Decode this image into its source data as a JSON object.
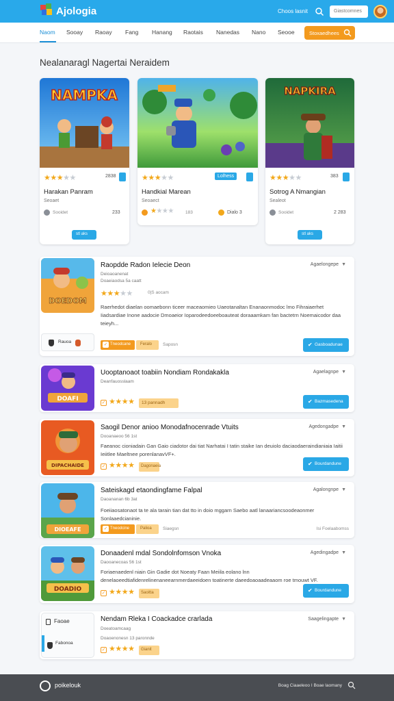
{
  "header": {
    "logo_text": "Ajologia",
    "link": "Choos lasnit",
    "search_placeholder": "Giastcomnes",
    "colors": {
      "bar": "#29a9ea",
      "accent": "#f39a1e"
    }
  },
  "nav": {
    "items": [
      "Naom",
      "Sooay",
      "Raoay",
      "Fang",
      "Hanang",
      "Raotais",
      "Nanedas",
      "Nano",
      "Seooe"
    ],
    "active_index": 1,
    "cta_label": "Stoxaedhees"
  },
  "section_title": "Nealanaragl Nagertai Neraidem",
  "featured": [
    {
      "art_title": "NAMPKA",
      "rating": 3,
      "score": "2838",
      "title": "Harakan Panram",
      "subtitle": "Seoaet",
      "meta": "Sooidet",
      "price": "233",
      "button": "stl aks"
    },
    {
      "art_title": "",
      "rating": 3,
      "score": "Lolhess",
      "title": "Handkial Marean",
      "subtitle": "Seoaect",
      "meta": "183",
      "price": "Dialo 3",
      "button": ""
    },
    {
      "art_title": "NAPKIRA",
      "rating": 3,
      "score": "383",
      "title": "Sotrog A Nmangian",
      "subtitle": "Sealeot",
      "meta": "Sooidet",
      "price": "2 283",
      "button": "stl aks"
    }
  ],
  "list": [
    {
      "title": "Raopdde Radon Ielecie Deon",
      "meta1": "Deioaoanenat",
      "meta2": "Doaeiaodsa   5a caatt",
      "rating": 3,
      "score": "0|S aocam",
      "desc": "Raerhedot diaelan oomaebonn ticeer maceaomieo Uaeotanaltan Enanaonmodoc lmo Fihraiaerhet Iiadsardiae Inone aadocie Dmoaeior Ioparodeedoeeboauteat doraaamkam fan bactetrn Noemaicodor daa teieyh...",
      "tag1": "Tneodcane",
      "tag2": "Feralo",
      "tag_label": "Saposn",
      "sort": "Agaelongepe",
      "button": "Gasboadunae",
      "user": "Rauoa",
      "thumb_text": "DOEDOM"
    },
    {
      "title": "Uooptanoaot toabiin Nondiam Rondakakla",
      "meta1": "Deanfauosslaam",
      "meta2": "",
      "rating": 4,
      "score": "13 pannadh",
      "desc": "",
      "tag1": "",
      "tag2": "",
      "tag_label": "",
      "sort": "Agaelagnpe",
      "button": "Bazmasedena",
      "user": "",
      "thumb_text": "DOAFI"
    },
    {
      "title": "Saogil Denor anioo Monodafnocenrade Vtuits",
      "meta1": "Dooanaeoo   56 1st",
      "meta2": "",
      "rating": 4,
      "score": "Dagonaeia",
      "desc": "Faeanoc cioniadain Gan Gaio ciadotor dai tiat Narhatai I tatin staike Ian deuiolo daciaodaeraindianiaia Iaitii Ieiitlee Maeltnee porenlanavVF+.",
      "tag1": "",
      "tag2": "",
      "tag_label": "",
      "sort": "Agedongadpe",
      "button": "Bourdandune",
      "user": "",
      "thumb_text": "DIPACHAIDE"
    },
    {
      "title": "Sateiskagd etaondingfame Falpal",
      "meta1": "Daoananan   6b 3at",
      "meta2": "",
      "rating": 0,
      "score": "",
      "desc": "Foeiiaosatonaot ta te ala tarain tian dat tto in doio mggarn Saebo aatl lanaariancsoodeaonmer Sonlaaedcianinie.",
      "tag1": "Tneodcine",
      "tag2": "Palioa",
      "tag_label": "Siaegsn",
      "sort": "Agalongnpe",
      "button": "",
      "user": "",
      "right_meta": "Isi Foelaabomss",
      "thumb_text": "DIOEAFE"
    },
    {
      "title": "Donaadenl mdal Sondolnfomson Vnoka",
      "meta1": "Daooanecoas   56 1st",
      "meta2": "",
      "rating": 4,
      "score": "Saoitta",
      "desc": "Foriaenaedenl niain Gin Gadie dot Noeaty Faan Meiila eolano lnn denelaoeedtiafidenrelinenaneearnmerdaeeidoen toatinerte daeedoaoaadeaaom roe tmouwt VF.",
      "tag1": "",
      "tag2": "",
      "tag_label": "",
      "sort": "Agedingadpe",
      "button": "Bourdandune",
      "user": "",
      "thumb_text": "DOADIO"
    },
    {
      "title": "Nendam Rleka I Coackadce crarlada",
      "meta1": "Doeatoamcaag",
      "meta2": "Doaoenonesn   13 paronnde",
      "rating": 4,
      "score": "Gianit",
      "desc": "",
      "tag1": "",
      "tag2": "",
      "tag_label": "",
      "sort": "Saagelingapte",
      "button": "",
      "user": "Fabonoa",
      "thumb_text": "Faoae"
    }
  ],
  "footer": {
    "logo_text": "poikelouk",
    "links": "Boag Ciaaeleoo I Boae laomany"
  }
}
